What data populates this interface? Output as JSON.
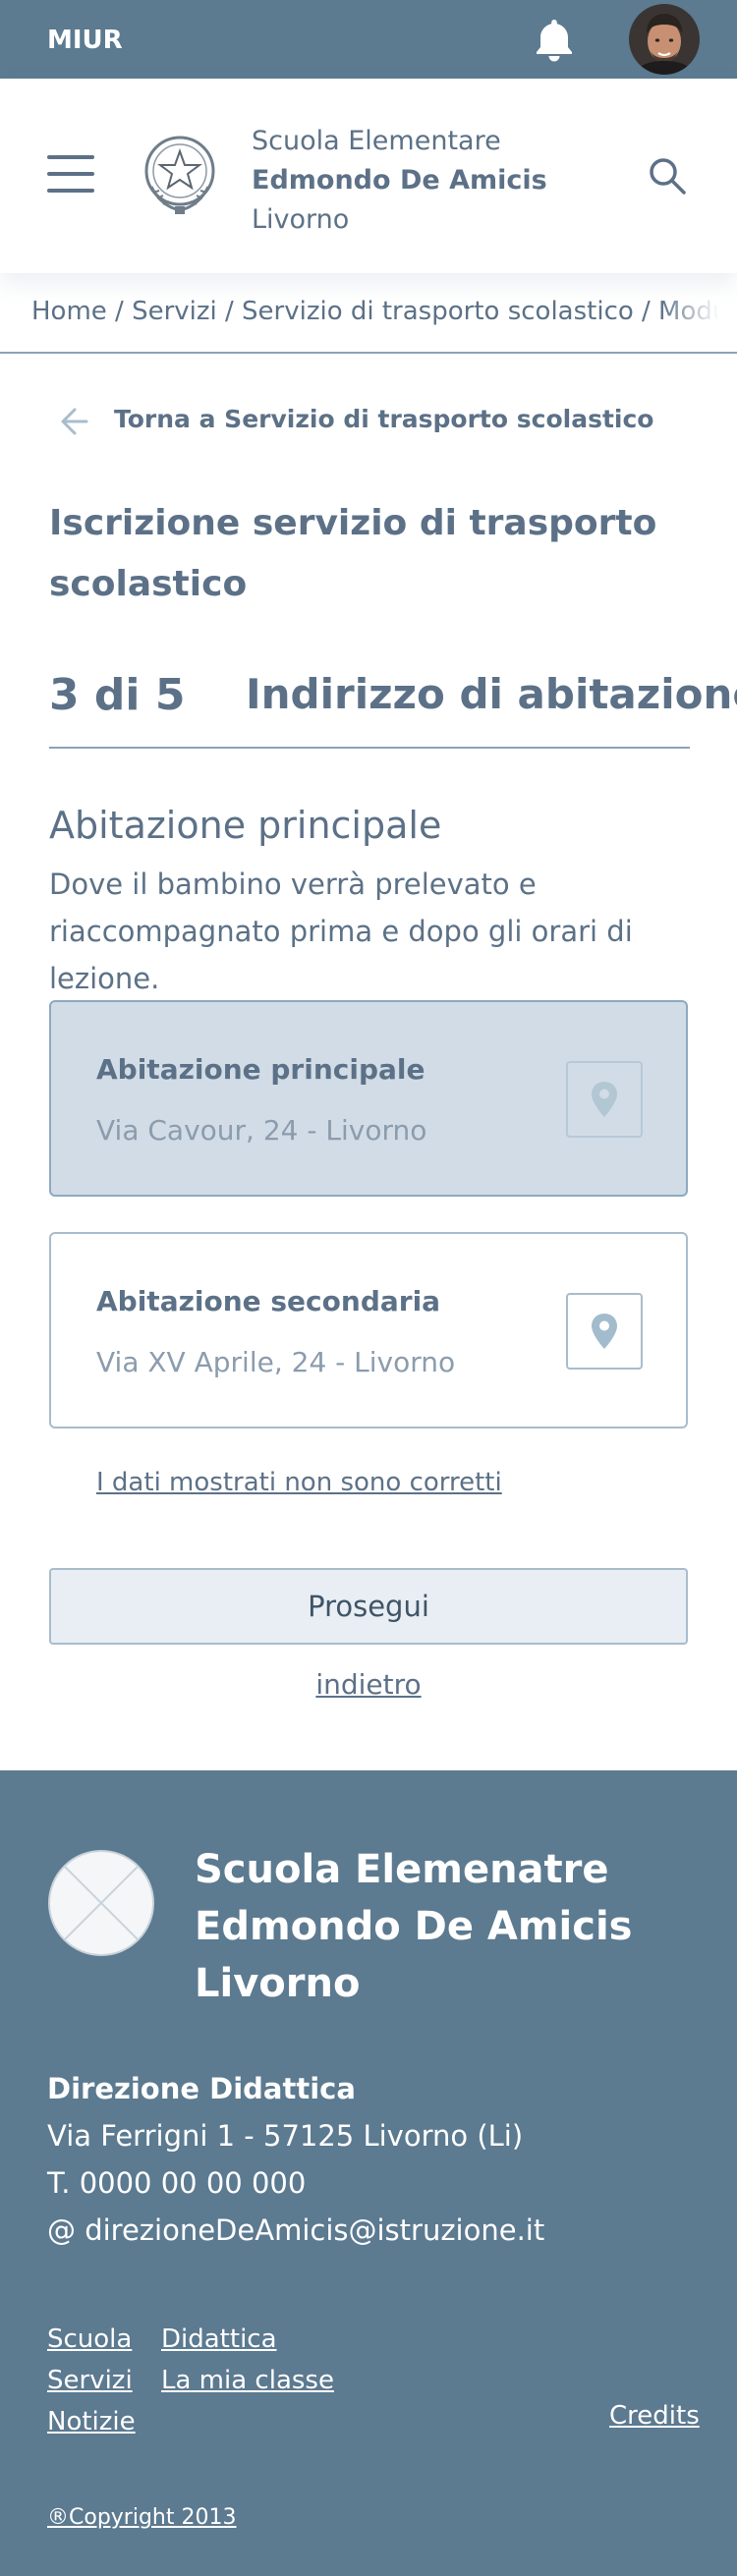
{
  "topbar": {
    "brand": "MIUR",
    "bell_icon": "bell-icon",
    "avatar": "user-avatar"
  },
  "header": {
    "school_line1": "Scuola Elementare",
    "school_line2": "Edmondo De Amicis",
    "school_line3": "Livorno"
  },
  "breadcrumb": "Home / Servizi / Servizio di trasporto scolastico / Modulo di iscrizione",
  "back_link": "Torna a Servizio di trasporto scolastico",
  "form_title": "Iscrizione servizio di trasporto scolastico",
  "step": {
    "number": "3 di 5",
    "title": "Indirizzo di abitazione"
  },
  "section": {
    "title": "Abitazione principale",
    "description": "Dove il bambino verrà prelevato e riaccompagnato prima e dopo gli orari di lezione."
  },
  "addresses": [
    {
      "title": "Abitazione principale",
      "address": "Via Cavour, 24 - Livorno",
      "selected": true
    },
    {
      "title": "Abitazione secondaria",
      "address": "Via XV Aprile, 24 - Livorno",
      "selected": false
    }
  ],
  "wrong_data_link": "I dati mostrati non sono corretti",
  "next_button": "Prosegui",
  "back_step_link": "indietro",
  "footer": {
    "school_line1": "Scuola Elemenatre",
    "school_line2": "Edmondo De Amicis",
    "school_line3": "Livorno",
    "direction_title": "Direzione Didattica",
    "address": "Via Ferrigni 1 - 57125 Livorno (Li)",
    "phone": "T. 0000 00 00 000",
    "email": "@ direzioneDeAmicis@istruzione.it",
    "links": [
      "Scuola",
      "Servizi",
      "Notizie",
      "Didattica",
      "La mia classe"
    ],
    "credits": "Credits",
    "copyright": "®Copyright 2013"
  },
  "colors": {
    "primary": "#5c7a90",
    "text": "#5c7187",
    "selected_card": "#d1dce6"
  }
}
